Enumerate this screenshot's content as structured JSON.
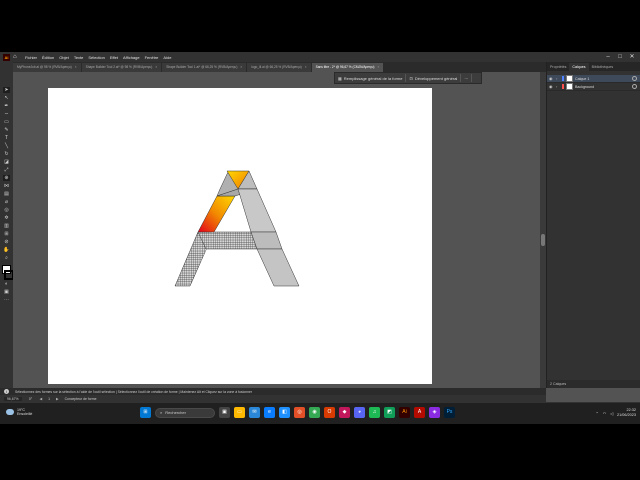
{
  "menu": {
    "app_logo": "Ai",
    "items": [
      "Fichier",
      "Édition",
      "Objet",
      "Texte",
      "Sélection",
      "Effet",
      "Affichage",
      "Fenêtre",
      "Aide"
    ]
  },
  "tabs": [
    {
      "label": "MyPhoneJob.ai @ 98 % (RVB/Aperçu)"
    },
    {
      "label": "Shape Builder Tool 2.ai* @ 98 % (RVB/Aperçu)"
    },
    {
      "label": "Shape Builder Tool 1.ai* @ 66,25 % (RVB/Aperçu)"
    },
    {
      "label": "logo_ill.ai @ 66,25 % (RVB/Aperçu)"
    },
    {
      "label": "Sans titre - 2* @ 96,67 % (CMJN/Aperçu)",
      "active": true
    }
  ],
  "context_bar": {
    "fill_label": "Remplissage général de la forme",
    "develop_label": "Développement général"
  },
  "panel": {
    "tabs": [
      "Propriétés",
      "Calques",
      "Bibliothèques"
    ],
    "active_tab": "Calques",
    "layers": [
      {
        "name": "Calque 1",
        "color": "#4f80ff",
        "selected": true
      },
      {
        "name": "Background",
        "color": "#ff4f4f",
        "selected": false
      }
    ],
    "footer": "2 Calques"
  },
  "hint": "Sélectionnez des formes sur la sélection à l'aide de l'outil sélection  |  Sélectionnez l'outil de création de forme  |  Maintenez Alt et Cliquez sur la zone à fusionner",
  "status": {
    "zoom": "96,67%",
    "rotation": "0°",
    "page": "1",
    "tool": "Concepteur de forme"
  },
  "taskbar": {
    "weather_temp": "19°C",
    "weather_desc": "Ensoleillé",
    "search_placeholder": "Rechercher",
    "time": "22:32",
    "date": "21/06/2023"
  },
  "colors": {
    "accent": "#1473e6",
    "gradient_start": "#e3001b",
    "gradient_end": "#ffd800",
    "shape_gray": "#c0c0c0"
  }
}
